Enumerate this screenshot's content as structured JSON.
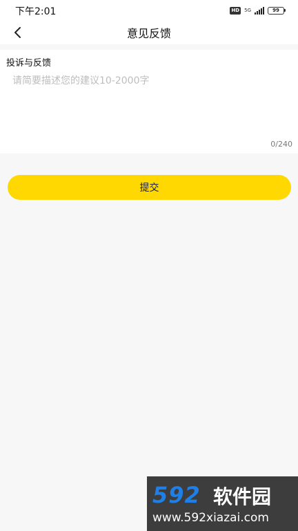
{
  "status_bar": {
    "time": "下午2:01",
    "hd_badge": "HD",
    "network": "5G",
    "battery": "99"
  },
  "nav": {
    "back_icon": "chevron-left-icon",
    "title": "意见反馈"
  },
  "feedback": {
    "label": "投诉与反馈",
    "placeholder": "请简要描述您的建议10-2000字",
    "value": "",
    "counter": "0/240"
  },
  "submit": {
    "label": "提交"
  },
  "watermark": {
    "brand": "592",
    "brand_cn": "软件园",
    "url": "www.592xiazai.com"
  },
  "colors": {
    "accent": "#fed800",
    "background": "#f7f7f7",
    "card": "#ffffff",
    "placeholder": "#bdbdbd"
  }
}
